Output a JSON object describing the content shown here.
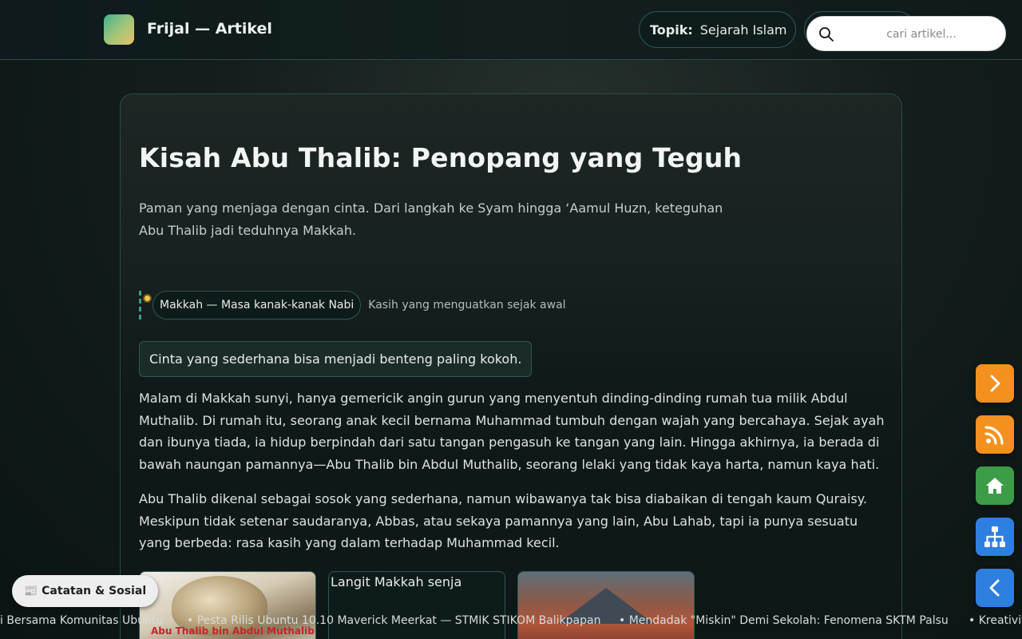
{
  "header": {
    "brand": "Frijal — Artikel",
    "topic_label": "Topik:",
    "topic_value": "Sejarah Islam",
    "search_placeholder": "cari artikel..."
  },
  "article": {
    "title": "Kisah Abu Thalib: Penopang yang Teguh",
    "subtitle": "Paman yang menjaga dengan cinta. Dari langkah ke Syam hingga ‘Aamul Huzn, keteguhan Abu Thalib jadi teduhnya Makkah.",
    "timeline": {
      "label": "Makkah — Masa kanak-kanak Nabi",
      "note": "Kasih yang menguatkan sejak awal"
    },
    "quote": "Cinta yang sederhana bisa menjadi benteng paling kokoh.",
    "paragraphs": [
      "Malam di Makkah sunyi, hanya gemericik angin gurun yang menyentuh dinding-dinding rumah tua milik Abdul Muthalib. Di rumah itu, seorang anak kecil bernama Muhammad tumbuh dengan wajah yang bercahaya. Sejak ayah dan ibunya tiada, ia hidup berpindah dari satu tangan pengasuh ke tangan yang lain. Hingga akhirnya, ia berada di bawah naungan pamannya—Abu Thalib bin Abdul Muthalib, seorang lelaki yang tidak kaya harta, namun kaya hati.",
      "Abu Thalib dikenal sebagai sosok yang sederhana, namun wibawanya tak bisa diabaikan di tengah kaum Quraisy. Meskipun tidak setenar saudaranya, Abbas, atau sekaya pamannya yang lain, Abu Lahab, tapi ia punya sesuatu yang berbeda: rasa kasih yang dalam terhadap Muhammad kecil."
    ],
    "gallery": [
      {
        "caption": "Abu Thalib bin Abdul Muthalib"
      },
      {
        "alt": "Langit Makkah senja"
      },
      {
        "alt": ""
      }
    ]
  },
  "fabs": [
    {
      "icon": "chevron-right-icon"
    },
    {
      "icon": "rss-icon"
    },
    {
      "icon": "home-icon"
    },
    {
      "icon": "sitemap-icon"
    },
    {
      "icon": "chevron-left-icon"
    }
  ],
  "notes_button": "📰 Catatan & Sosial",
  "ticker": [
    "i Bersama Komunitas Ubuntu",
    "• Pesta Rilis Ubuntu 10.10 Maverick Meerkat — STMIK STIKOM Balikpapan",
    "• Mendadak \"Miskin\" Demi Sekolah: Fenomena SKTM Palsu",
    "• Kreativit"
  ],
  "colors": {
    "accent_orange": "#f4901e",
    "accent_green": "#3d9c47",
    "accent_blue": "#2f7fe0",
    "timeline_dot": "#f2c94c"
  }
}
